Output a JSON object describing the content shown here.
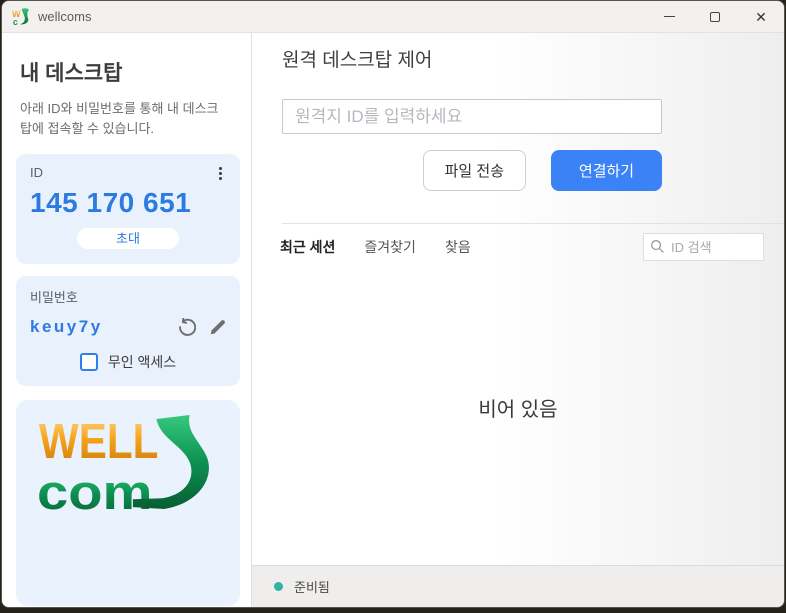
{
  "window": {
    "title": "wellcoms",
    "controls": {
      "minimize_icon": "minimize-icon",
      "maximize_icon": "maximize-icon",
      "close_icon": "close-icon",
      "close_glyph": "✕"
    }
  },
  "sidebar": {
    "heading": "내 데스크탑",
    "description": "아래 ID와 비밀번호를 통해 내 데스크탑에 접속할 수 있습니다.",
    "id_card": {
      "label": "ID",
      "value": "145 170 651",
      "invite_label": "초대",
      "menu_icon": "kebab-vertical-icon"
    },
    "password_card": {
      "label": "비밀번호",
      "value": "keuy7y",
      "refresh_icon": "refresh-icon",
      "edit_icon": "pencil-icon",
      "unattended_label": "무인 액세스",
      "unattended_checked": false
    },
    "logo": {
      "line1": "WELL",
      "line2": "com"
    }
  },
  "main": {
    "heading": "원격 데스크탑 제어",
    "id_input_placeholder": "원격지 ID를 입력하세요",
    "file_transfer_label": "파일 전송",
    "connect_label": "연결하기",
    "tabs": [
      {
        "label": "최근 세션",
        "active": true
      },
      {
        "label": "즐겨찾기",
        "active": false
      },
      {
        "label": "찾음",
        "active": false
      }
    ],
    "search_placeholder": "ID 검색",
    "search_icon": "magnifier-icon",
    "empty_text": "비어 있음",
    "status": {
      "text": "준비됨",
      "dot_color": "#2fb3a3"
    }
  },
  "colors": {
    "accent_blue": "#3b82f6",
    "id_blue": "#2c7be0",
    "card_bg": "#e9f1fc",
    "status_teal": "#2fb3a3",
    "logo_orange": "#f6a21c",
    "logo_green": "#0d9152"
  }
}
